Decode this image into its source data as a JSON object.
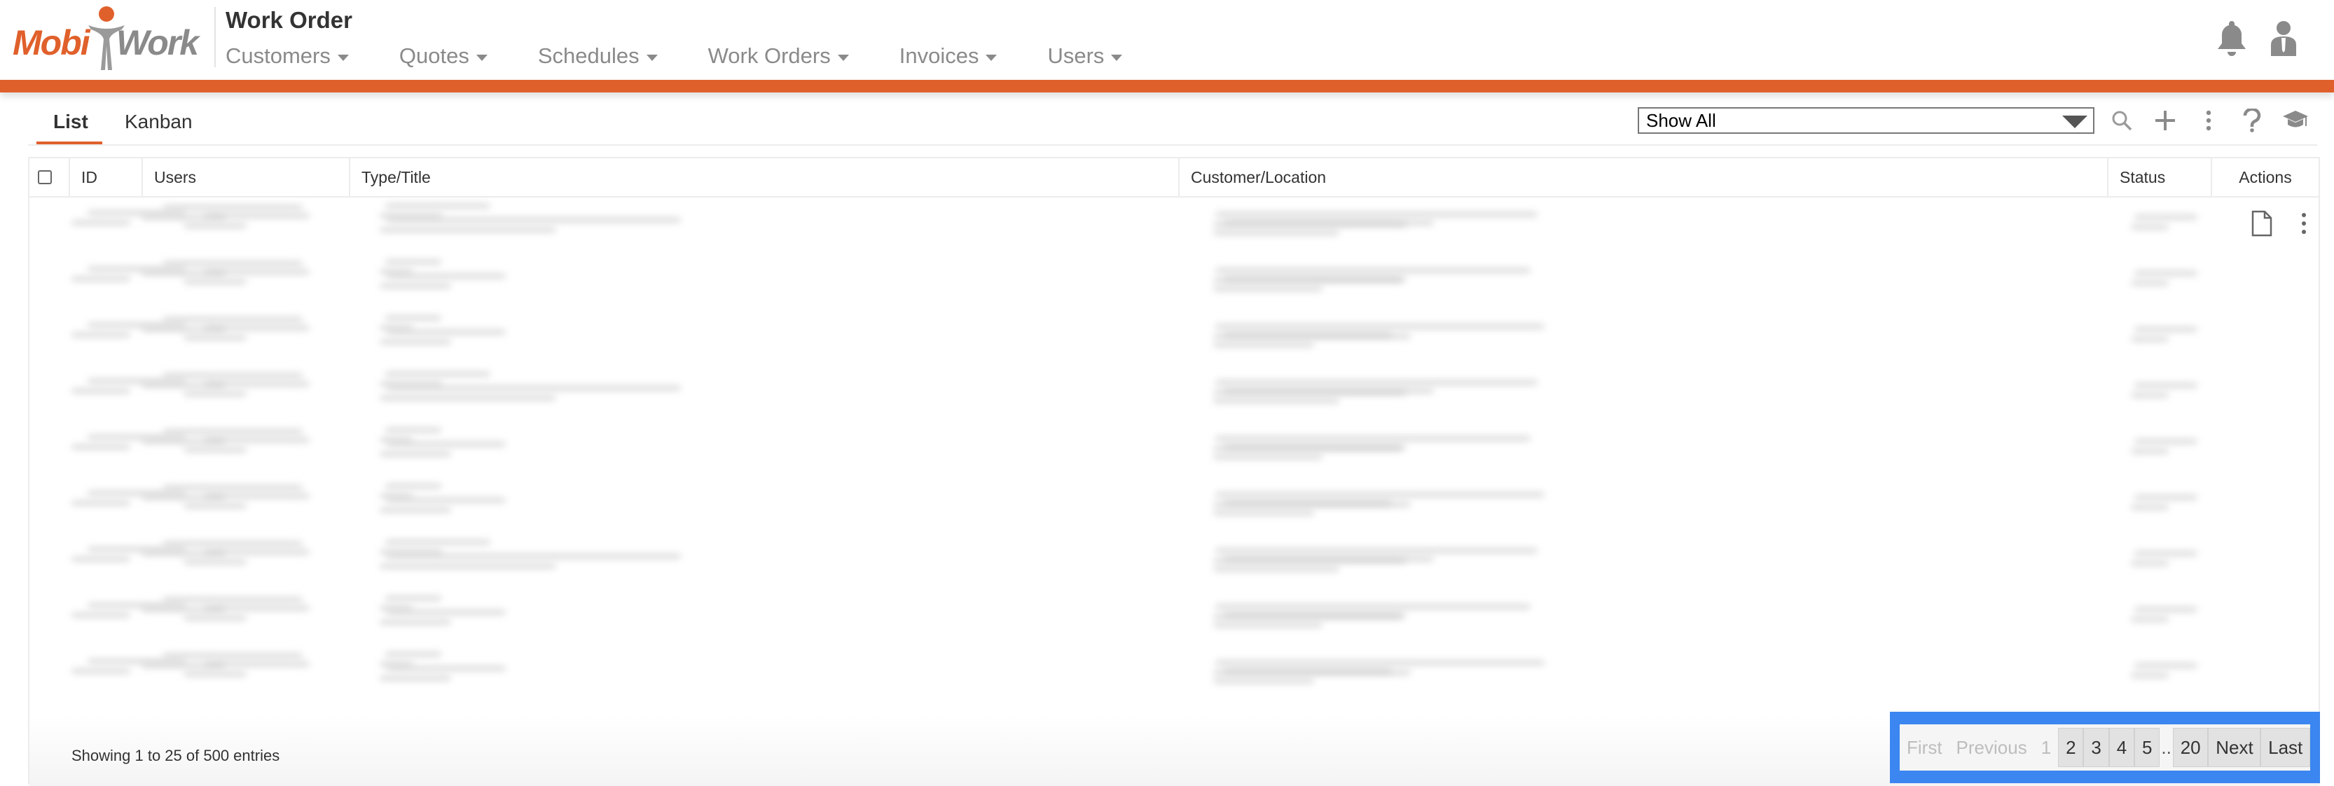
{
  "header": {
    "logo": {
      "mobi": "Mobi",
      "work": "Work"
    },
    "title": "Work Order",
    "nav": [
      {
        "label": "Customers"
      },
      {
        "label": "Quotes"
      },
      {
        "label": "Schedules"
      },
      {
        "label": "Work Orders"
      },
      {
        "label": "Invoices"
      },
      {
        "label": "Users"
      }
    ],
    "icons": [
      "bell-icon",
      "user-icon"
    ]
  },
  "colors": {
    "accent": "#e0602b",
    "highlight": "#3b86f0",
    "muted": "#8a8a8a"
  },
  "toolbar": {
    "tabs": [
      {
        "label": "List",
        "active": true
      },
      {
        "label": "Kanban",
        "active": false
      }
    ],
    "filter": {
      "selected": "Show All"
    },
    "icons": [
      "search-icon",
      "plus-icon",
      "more-vertical-icon",
      "help-icon",
      "graduation-cap-icon"
    ]
  },
  "table": {
    "columns": [
      "ID",
      "Users",
      "Type/Title",
      "Customer/Location",
      "Status",
      "Actions"
    ],
    "visible_rows": 9,
    "row_content": "blurred",
    "row_action_icons": [
      "document-icon",
      "more-vertical-icon"
    ]
  },
  "footer": {
    "showing": "Showing 1 to 25 of 500 entries"
  },
  "pagination": {
    "first": "First",
    "previous": "Previous",
    "current": "1",
    "pages": [
      "2",
      "3",
      "4",
      "5"
    ],
    "ellipsis": "..",
    "last_page": "20",
    "next": "Next",
    "last": "Last"
  }
}
